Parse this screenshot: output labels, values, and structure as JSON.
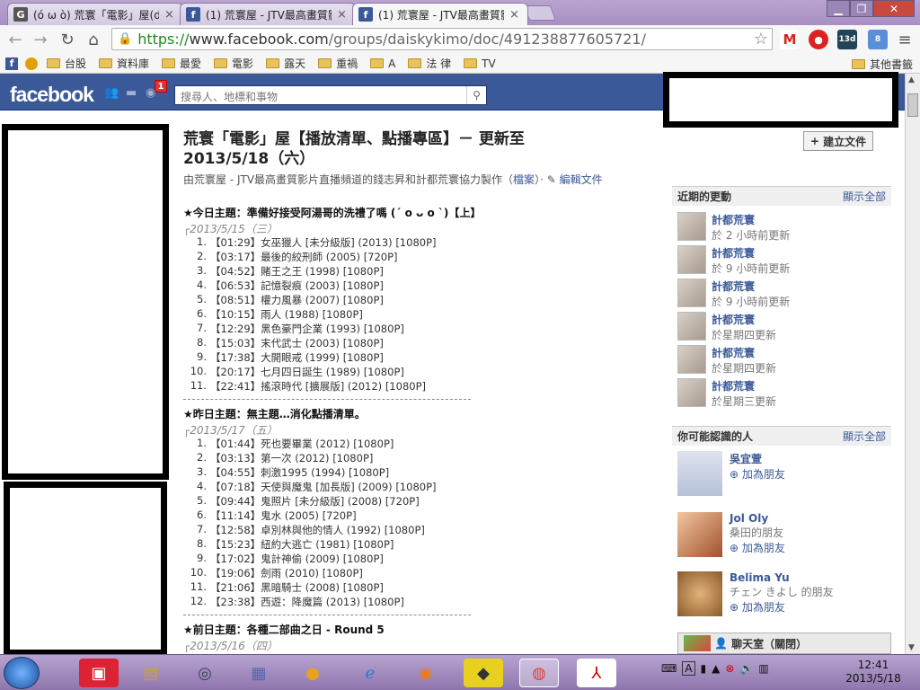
{
  "browser": {
    "tabs": [
      {
        "icon": "G",
        "title": "(ó ω ò) 荒寰「電影」屋(d",
        "color": "#555555",
        "active": false
      },
      {
        "icon": "f",
        "title": "(1) 荒寰屋 - JTV最高畫質影",
        "color": "#3b5998",
        "active": false
      },
      {
        "icon": "f",
        "title": "(1) 荒寰屋 - JTV最高畫質影",
        "color": "#3b5998",
        "active": true
      }
    ],
    "url_scheme": "https://",
    "url_host": "www.facebook.com",
    "url_path": "/groups/daiskykimo/doc/491238877605721/",
    "extension_badges": {
      "calendar": "13d",
      "notify": "8"
    },
    "bookmarks": [
      "台股",
      "資料庫",
      "最愛",
      "電影",
      "露天",
      "重禍",
      "A",
      "法 律",
      "TV"
    ],
    "other_bookmarks": "其他書籤"
  },
  "fb": {
    "logo": "facebook",
    "notif_count": "1",
    "search_placeholder": "搜尋人、地標和事物",
    "create_doc": "建立文件"
  },
  "doc": {
    "title": "荒寰「電影」屋【播放清單、點播專區】－ 更新至 2013/5/18（六）",
    "byline_prefix": "由荒寰屋 - JTV最高畫質影片直播頻道的錢志昇和計都荒寰協力製作（",
    "byline_link": "檔案",
    "byline_suffix": "）·",
    "edit_label": "編輯文件",
    "sections": [
      {
        "heading": "★今日主題：準備好接受阿湯哥的洗禮了嗎 (ˊ o ᴗ o ˋ)【上】",
        "date": "┌2013/5/15（三）",
        "items": [
          "【01:29】女巫獵人 [未分級版] (2013) [1080P]",
          "【03:17】最後的絞刑師 (2005) [720P]",
          "【04:52】賭王之王 (1998) [1080P]",
          "【06:53】記憶裂痕 (2003) [1080P]",
          "【08:51】權力風暴 (2007) [1080P]",
          "【10:15】雨人 (1988) [1080P]",
          "【12:29】黑色豪門企業 (1993) [1080P]",
          "【15:03】末代武士 (2003) [1080P]",
          "【17:38】大開眼戒 (1999) [1080P]",
          "【20:17】七月四日誕生 (1989) [1080P]",
          "【22:41】搖滾時代 [擴展版] (2012) [1080P]"
        ]
      },
      {
        "heading": "★昨日主題：無主題…消化點播清單。",
        "date": "┌2013/5/17（五）",
        "items": [
          "【01:44】死也要畢業 (2012) [1080P]",
          "【03:13】第一次 (2012) [1080P]",
          "【04:55】刺激1995 (1994) [1080P]",
          "【07:18】天使與魔鬼 [加長版] (2009) [1080P]",
          "【09:44】鬼照片 [未分級版] (2008) [720P]",
          "【11:14】鬼水 (2005) [720P]",
          "【12:58】卓別林與他的情人 (1992) [1080P]",
          "【15:23】紐約大逃亡 (1981) [1080P]",
          "【17:02】鬼計神偷 (2009) [1080P]",
          "【19:06】劍雨 (2010) [1080P]",
          "【21:06】黑暗騎士 (2008) [1080P]",
          "【23:38】西遊：降魔篇 (2013) [1080P]"
        ]
      },
      {
        "heading": "★前日主題：各種二部曲之日 - Round 5",
        "date": "┌2013/5/16（四）",
        "items": []
      }
    ]
  },
  "rail": {
    "updates_title": "近期的更動",
    "see_all": "顯示全部",
    "updates": [
      {
        "name": "計都荒寰",
        "time": "於 2 小時前更新"
      },
      {
        "name": "計都荒寰",
        "time": "於 9 小時前更新"
      },
      {
        "name": "計都荒寰",
        "time": "於 9 小時前更新"
      },
      {
        "name": "計都荒寰",
        "time": "於星期四更新"
      },
      {
        "name": "計都荒寰",
        "time": "於星期四更新"
      },
      {
        "name": "計都荒寰",
        "time": "於星期三更新"
      }
    ],
    "pymk_title": "你可能認識的人",
    "people": [
      {
        "name": "吳宜萱",
        "mutual": "",
        "add": "加為朋友"
      },
      {
        "name": "Jol Oly",
        "mutual": "桑田的朋友",
        "add": "加為朋友"
      },
      {
        "name": "Belima Yu",
        "mutual": "チェン きよし 的朋友",
        "add": "加為朋友"
      }
    ],
    "chat_label": "聊天室（關閉）"
  },
  "taskbar": {
    "time": "12:41",
    "date": "2013/5/18"
  }
}
